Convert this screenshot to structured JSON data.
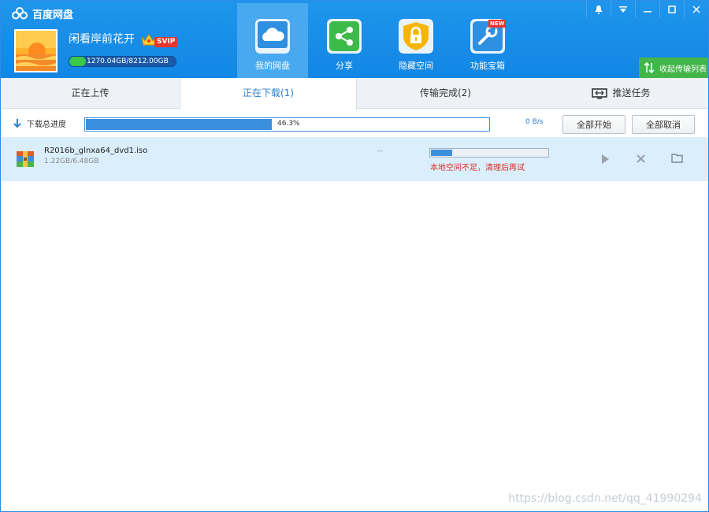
{
  "app": {
    "title": "百度网盘"
  },
  "user": {
    "name": "闲看岸前花开",
    "vip_badge": "SVIP",
    "quota_text": "1270.04GB/8212.00GB",
    "quota_fraction": 0.155
  },
  "nav": {
    "items": [
      {
        "label": "我的网盘",
        "icon": "cloud-icon",
        "active": true
      },
      {
        "label": "分享",
        "icon": "share-icon",
        "active": false
      },
      {
        "label": "隐藏空间",
        "icon": "lock-icon",
        "active": false
      },
      {
        "label": "功能宝箱",
        "icon": "wrench-icon",
        "active": false,
        "badge": "NEW"
      }
    ]
  },
  "window_controls": [
    "bell-icon",
    "dropdown-icon",
    "minimize-icon",
    "maximize-icon",
    "close-icon"
  ],
  "collapse_button": {
    "label": "收起传输列表"
  },
  "tabs": [
    {
      "label": "正在上传"
    },
    {
      "label": "正在下载(1)",
      "active": true
    },
    {
      "label": "传输完成(2)"
    },
    {
      "label": "推送任务"
    }
  ],
  "total": {
    "label": "下载总进度",
    "percent_text": "46.3%",
    "fraction": 0.463,
    "speed": "0 B/s",
    "start_all": "全部开始",
    "cancel_all": "全部取消"
  },
  "download": {
    "name": "R2016b_glnxa64_dvd1.iso",
    "size": "1.22GB/6.48GB",
    "time": "--",
    "fraction": 0.19,
    "error": "本地空间不足，清理后再试"
  },
  "watermark": "https://blog.csdn.net/qq_41990294",
  "colors": {
    "primary": "#1286e4",
    "accent_green": "#43b649",
    "error": "#d93025"
  }
}
